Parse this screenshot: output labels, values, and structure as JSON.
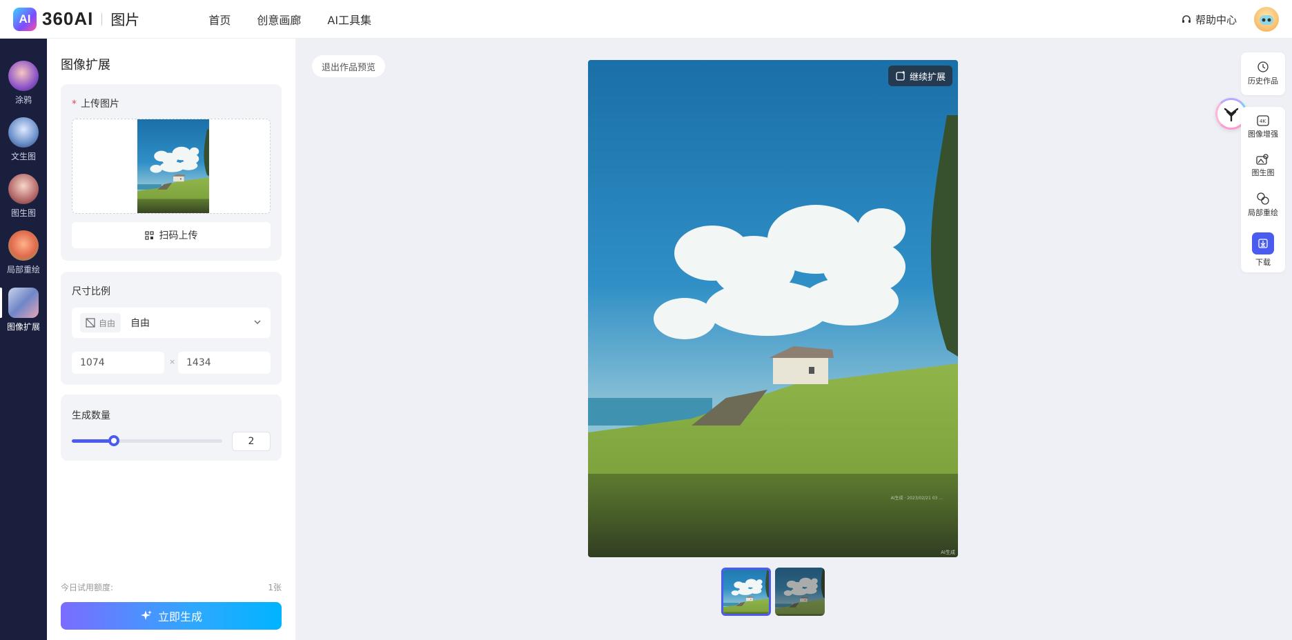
{
  "header": {
    "logo_mark": "AI",
    "logo_text": "360AI",
    "logo_sub": "图片",
    "nav": [
      "首页",
      "创意画廊",
      "AI工具集"
    ],
    "help": "帮助中心"
  },
  "rail": {
    "items": [
      {
        "label": "涂鸦"
      },
      {
        "label": "文生图"
      },
      {
        "label": "图生图"
      },
      {
        "label": "局部重绘"
      },
      {
        "label": "图像扩展",
        "active": true
      }
    ]
  },
  "panel": {
    "title": "图像扩展",
    "upload": {
      "required_mark": "*",
      "label": "上传图片",
      "scan_label": "扫码上传"
    },
    "ratio": {
      "label": "尺寸比例",
      "chip": "自由",
      "value": "自由",
      "width": "1074",
      "height": "1434",
      "times": "×"
    },
    "count": {
      "label": "生成数量",
      "value": "2",
      "level": 0.28
    },
    "quota_label": "今日试用额度:",
    "quota_value": "1张",
    "generate_label": "立即生成"
  },
  "main": {
    "exit_label": "退出作品预览",
    "continue_label": "继续扩展",
    "watermark": "AI生成",
    "watermark2": "AI生成 · 2023/02/21 03 ..."
  },
  "tools": {
    "history": "历史作品",
    "enhance": "图像增强",
    "img2img": "图生图",
    "inpaint": "局部重绘",
    "download": "下载"
  },
  "colors": {
    "accent": "#4a5cf0",
    "rail_bg": "#1a1f3d",
    "required": "#e5484d"
  }
}
